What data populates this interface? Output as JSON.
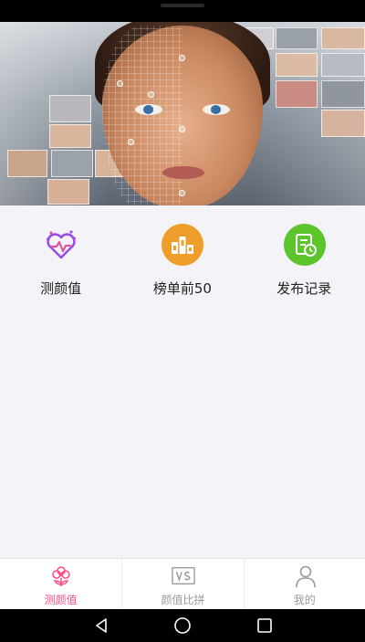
{
  "menu": {
    "items": [
      {
        "label": "测颜值",
        "icon": "heart-pulse-icon",
        "color": "#9a4de6"
      },
      {
        "label": "榜单前50",
        "icon": "ranking-podium-icon",
        "color": "#ef9d2b"
      },
      {
        "label": "发布记录",
        "icon": "document-clock-icon",
        "color": "#5cc52c"
      }
    ]
  },
  "tabbar": {
    "active_color": "#ff4f86",
    "inactive_color": "#9a9a9a",
    "items": [
      {
        "label": "测颜值",
        "icon": "flower-icon",
        "active": true
      },
      {
        "label": "颜值比拼",
        "icon": "vs-icon",
        "active": false
      },
      {
        "label": "我的",
        "icon": "person-icon",
        "active": false
      }
    ]
  },
  "system_nav": {
    "back": "back-triangle-icon",
    "home": "home-circle-icon",
    "recent": "recent-square-icon"
  }
}
